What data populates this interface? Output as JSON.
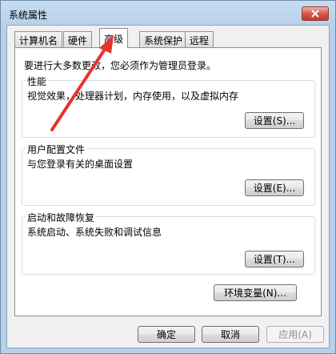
{
  "window": {
    "title": "系统属性"
  },
  "tabs": [
    {
      "label": "计算机名"
    },
    {
      "label": "硬件"
    },
    {
      "label": "高级"
    },
    {
      "label": "系统保护"
    },
    {
      "label": "远程"
    }
  ],
  "advanced": {
    "admin_note": "要进行大多数更改，您必须作为管理员登录。",
    "groups": [
      {
        "title": "性能",
        "description": "视觉效果，处理器计划，内存使用，以及虚拟内存",
        "button": "设置(S)..."
      },
      {
        "title": "用户配置文件",
        "description": "与您登录有关的桌面设置",
        "button": "设置(E)..."
      },
      {
        "title": "启动和故障恢复",
        "description": "系统启动、系统失败和调试信息",
        "button": "设置(T)..."
      }
    ],
    "env_button": "环境变量(N)..."
  },
  "footer": {
    "ok": "确定",
    "cancel": "取消",
    "apply": "应用(A)"
  },
  "colors": {
    "annotation_arrow": "#e8332e",
    "close_button": "#c0392b"
  },
  "icons": {
    "close": "close-icon"
  }
}
